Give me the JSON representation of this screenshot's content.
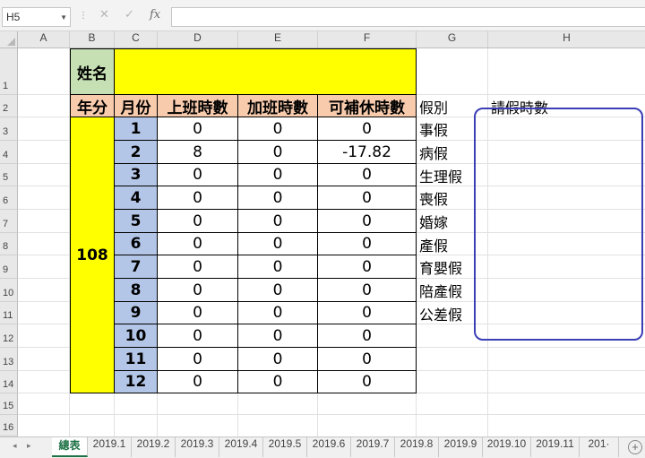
{
  "formula_bar": {
    "name_box": "H5",
    "formula": "",
    "fx_label": "fx",
    "cancel_glyph": "✕",
    "enter_glyph": "✓"
  },
  "columns": [
    "A",
    "B",
    "C",
    "D",
    "E",
    "F",
    "G",
    "H"
  ],
  "rows": [
    "1",
    "2",
    "3",
    "4",
    "5",
    "6",
    "7",
    "8",
    "9",
    "10",
    "11",
    "12",
    "13",
    "14",
    "15",
    "16"
  ],
  "sheet": {
    "name_label": "姓名",
    "name_value": "",
    "headers": [
      "年分",
      "月份",
      "上班時數",
      "加班時數",
      "可補休時數"
    ],
    "year": "108",
    "months": [
      "1",
      "2",
      "3",
      "4",
      "5",
      "6",
      "7",
      "8",
      "9",
      "10",
      "11",
      "12"
    ],
    "work_hours": [
      "0",
      "8",
      "0",
      "0",
      "0",
      "0",
      "0",
      "0",
      "0",
      "0",
      "0",
      "0"
    ],
    "overtime_hours": [
      "0",
      "0",
      "0",
      "0",
      "0",
      "0",
      "0",
      "0",
      "0",
      "0",
      "0",
      "0"
    ],
    "comp_hours": [
      "0",
      "-17.82",
      "0",
      "0",
      "0",
      "0",
      "0",
      "0",
      "0",
      "0",
      "0",
      "0"
    ],
    "leave_type_header": "假別",
    "leave_hours_header": "請假時數",
    "leave_types": [
      "事假",
      "病假",
      "生理假",
      "喪假",
      "婚嫁",
      "產假",
      "育嬰假",
      "陪產假",
      "公差假"
    ]
  },
  "sheet_tabs": [
    "總表",
    "2019.1",
    "2019.2",
    "2019.3",
    "2019.4",
    "2019.5",
    "2019.6",
    "2019.7",
    "2019.8",
    "2019.9",
    "2019.10",
    "2019.11",
    "201·"
  ],
  "active_tab": "總表",
  "colors": {
    "yellow": "#ffff00",
    "name_green": "#c6e0b4",
    "header_peach": "#f8cbad",
    "month_blue": "#b4c6e7",
    "shape_blue": "#3b3fb6",
    "tab_green": "#1e7145"
  },
  "icons": {
    "name_box_dropdown": "chevron-down-icon",
    "cancel": "close-icon",
    "enter": "check-icon",
    "add_sheet": "plus-icon"
  }
}
